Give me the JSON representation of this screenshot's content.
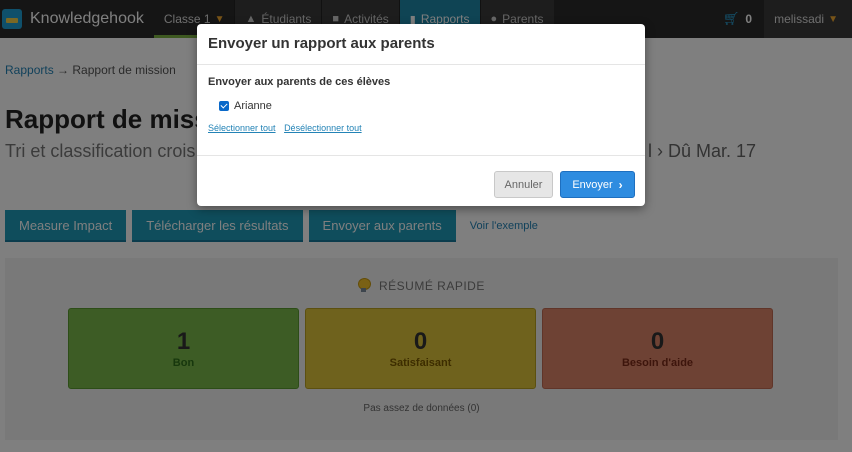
{
  "navbar": {
    "brand": "Knowledgehook",
    "class_selector": "Classe 1",
    "tabs": [
      {
        "label": "Étudiants",
        "icon": "graduation-cap-icon"
      },
      {
        "label": "Activités",
        "icon": "book-icon"
      },
      {
        "label": "Rapports",
        "icon": "bar-chart-icon"
      },
      {
        "label": "Parents",
        "icon": "users-icon"
      }
    ],
    "cart_count": "0",
    "username": "melissadi"
  },
  "breadcrumb": {
    "link": "Rapports",
    "separator": "→",
    "current": "Rapport de mission"
  },
  "page": {
    "title": "Rapport de miss",
    "subtitle": "Tri et classification crois",
    "due_fragment": "l",
    "due_date": "Dû Mar. 17"
  },
  "actions": {
    "measure_impact": "Measure Impact",
    "download_results": "Télécharger les résultats",
    "send_to_parents": "Envoyer aux parents",
    "see_example": "Voir l'exemple"
  },
  "summary": {
    "heading": "RÉSUMÉ RAPIDE",
    "cards": [
      {
        "value": "1",
        "label": "Bon",
        "color": "#7bb94a"
      },
      {
        "value": "0",
        "label": "Satisfaisant",
        "color": "#dfc53a"
      },
      {
        "value": "0",
        "label": "Besoin d'aide",
        "color": "#dd8468"
      }
    ],
    "no_data": "Pas assez de données (0)"
  },
  "modal": {
    "title": "Envoyer un rapport aux parents",
    "section_label": "Envoyer aux parents de ces élèves",
    "students": [
      {
        "name": "Arianne",
        "checked": true
      }
    ],
    "select_all": "Sélectionner tout",
    "deselect_all": "Désélectionner tout",
    "cancel": "Annuler",
    "send": "Envoyer"
  },
  "colors": {
    "navbar_bg": "#2b2b2b",
    "active_tab": "#1e88a8",
    "action_button": "#1e9ab8",
    "primary_button": "#2e8ce0",
    "link": "#2383b6"
  }
}
